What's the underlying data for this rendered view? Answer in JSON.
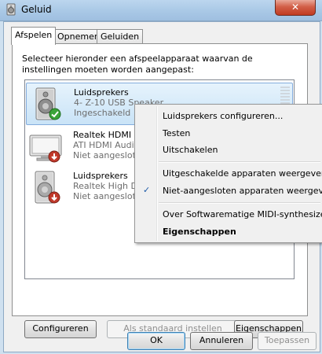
{
  "window": {
    "title": "Geluid",
    "close_glyph": "✕"
  },
  "tabs": [
    {
      "label": "Afspelen",
      "active": true
    },
    {
      "label": "Opnemen",
      "active": false
    },
    {
      "label": "Geluiden",
      "active": false
    }
  ],
  "description": "Selecteer hieronder een afspeelapparaat waarvan de instellingen moeten worden aangepast:",
  "devices": [
    {
      "name": "Luidsprekers",
      "description": "4- Z-10 USB Speaker",
      "status": "Ingeschakeld",
      "icon": "speaker-icon",
      "status_icon": "check-badge-icon",
      "selected": true
    },
    {
      "name": "Realtek HDMI O",
      "description": "ATI HDMI Audio",
      "status": "Niet aangesloten",
      "icon": "monitor-icon",
      "status_icon": "down-arrow-badge-icon",
      "selected": false
    },
    {
      "name": "Luidsprekers",
      "description": "Realtek High De",
      "status": "Niet aangesloten",
      "icon": "speaker-icon",
      "status_icon": "down-arrow-badge-icon",
      "selected": false
    }
  ],
  "panel_buttons": {
    "configure": "Configureren",
    "set_default": "Als standaard instellen",
    "properties": "Eigenschappen"
  },
  "dialog_buttons": {
    "ok": "OK",
    "cancel": "Annuleren",
    "apply": "Toepassen"
  },
  "context_menu": {
    "configure_speakers": "Luidsprekers configureren...",
    "test": "Testen",
    "disable": "Uitschakelen",
    "show_disabled": "Uitgeschakelde apparaten weergeven",
    "show_disconnected": "Niet-aangesloten apparaten weergeven",
    "show_disconnected_checked": true,
    "check_glyph": "✓",
    "about_midi": "Over Softwarematige MIDI-synthesizer",
    "properties": "Eigenschappen"
  },
  "colors": {
    "selection": "#c9e3f7",
    "check_badge": "#3aa43a",
    "disconnected_badge": "#c0392b"
  }
}
